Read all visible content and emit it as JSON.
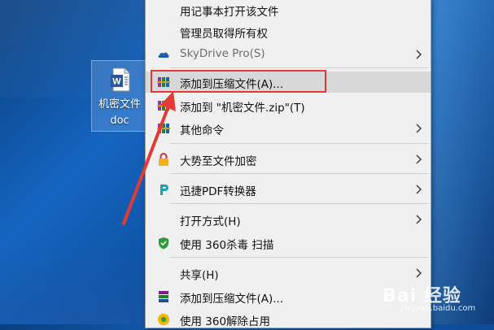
{
  "desktop": {
    "file": {
      "label_line1": "机密文件",
      "label_line2": "doc",
      "icon": "word-document-icon"
    }
  },
  "menu": {
    "items": [
      {
        "label": "用记事本打开该文件",
        "icon": "",
        "submenu": false,
        "disabled": false
      },
      {
        "label": "管理员取得所有权",
        "icon": "",
        "submenu": false,
        "disabled": false
      },
      {
        "label": "SkyDrive Pro(S)",
        "icon": "cloud-icon",
        "submenu": true,
        "disabled": true
      },
      {
        "label": "添加到压缩文件(A)...",
        "icon": "winrar-icon",
        "submenu": false,
        "disabled": false,
        "highlighted": true
      },
      {
        "label": "添加到 \"机密文件.zip\"(T)",
        "icon": "winrar-icon",
        "submenu": false,
        "disabled": false
      },
      {
        "label": "其他命令",
        "icon": "winrar-icon",
        "submenu": true,
        "disabled": false
      },
      {
        "label": "大势至文件加密",
        "icon": "lock-icon",
        "submenu": true,
        "disabled": false
      },
      {
        "label": "迅捷PDF转换器",
        "icon": "pdf-converter-icon",
        "submenu": true,
        "disabled": false
      },
      {
        "label": "打开方式(H)",
        "icon": "",
        "submenu": true,
        "disabled": false
      },
      {
        "label": "使用 360杀毒 扫描",
        "icon": "shield-icon",
        "submenu": false,
        "disabled": false
      },
      {
        "label": "共享(H)",
        "icon": "",
        "submenu": true,
        "disabled": false
      },
      {
        "label": "添加到压缩文件(A)...",
        "icon": "winrar-books-icon",
        "submenu": false,
        "disabled": false
      },
      {
        "label": "使用 360解除占用",
        "icon": "360-icon",
        "submenu": false,
        "disabled": false
      }
    ]
  },
  "watermark": {
    "text": "Bai 经验",
    "url": "jingyan.baidu.com"
  },
  "colors": {
    "highlight_box": "#e53935",
    "menu_bg": "#f0f0f0",
    "hover_bg": "#d8d8d8"
  }
}
